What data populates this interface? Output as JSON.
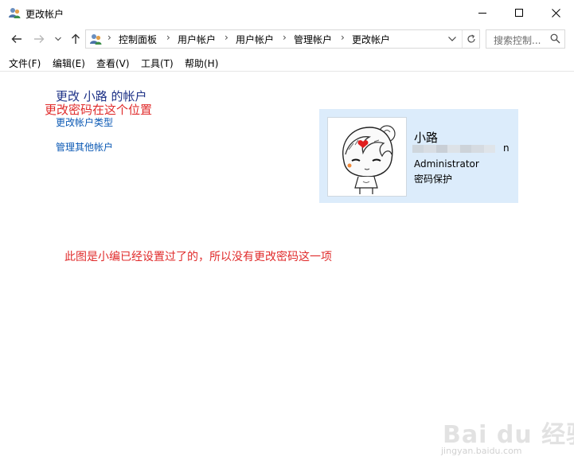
{
  "window": {
    "title": "更改帐户"
  },
  "nav": {
    "breadcrumbs": [
      "控制面板",
      "用户帐户",
      "用户帐户",
      "管理帐户",
      "更改帐户"
    ],
    "search_placeholder": "搜索控制..."
  },
  "menu": {
    "items": [
      "文件(F)",
      "编辑(E)",
      "查看(V)",
      "工具(T)",
      "帮助(H)"
    ]
  },
  "main": {
    "title": "更改 小路 的帐户",
    "links": [
      "更改帐户类型",
      "管理其他帐户"
    ]
  },
  "account": {
    "name": "小路",
    "blurred_email_tail": "n",
    "role": "Administrator",
    "status": "密码保护"
  },
  "annotations": {
    "note_top": "更改密码在这个位置",
    "note_bottom": "此图是小编已经设置过了的，所以没有更改密码这一项"
  },
  "watermark": {
    "brand": "Bai du 经验",
    "url": "jingyan.baidu.com"
  },
  "colors": {
    "link": "#0a58b4",
    "heading": "#1e3287",
    "annotation": "#e02b2b",
    "card_bg": "#dcecfb"
  }
}
